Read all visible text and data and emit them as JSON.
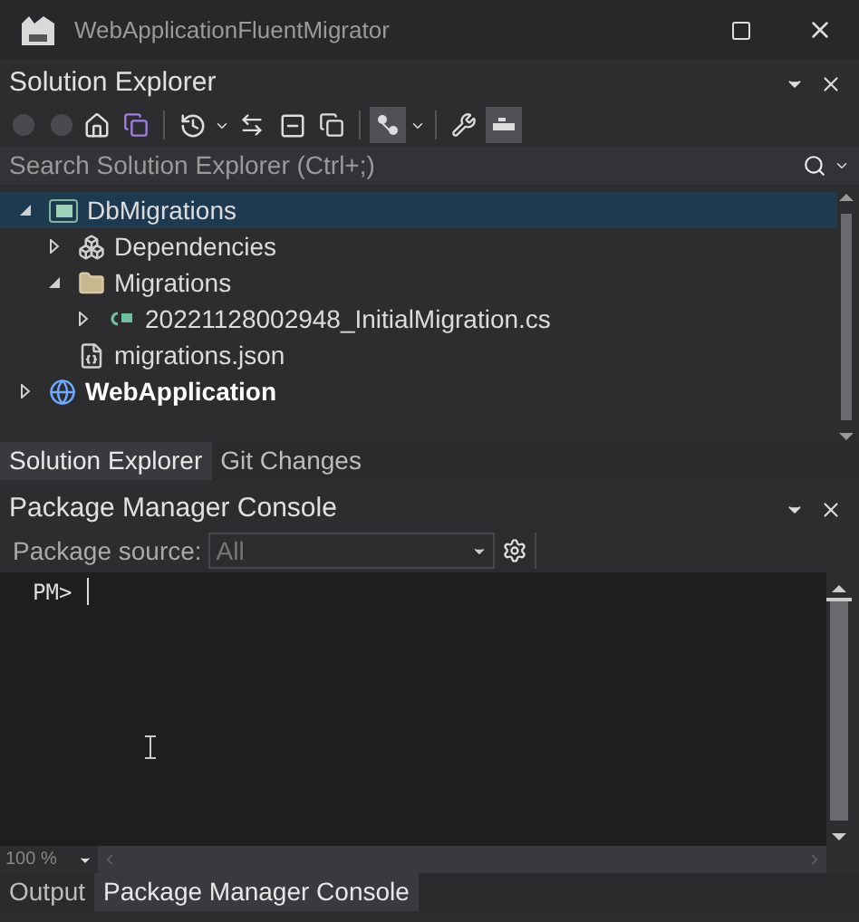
{
  "window": {
    "title": "WebApplicationFluentMigrator"
  },
  "solution_explorer": {
    "title": "Solution Explorer",
    "search": {
      "placeholder": "Search Solution Explorer (Ctrl+;)"
    },
    "tree": [
      {
        "label": "DbMigrations",
        "kind": "project",
        "expanded": true,
        "selected": true,
        "startup": false,
        "children": [
          {
            "label": "Dependencies",
            "kind": "dependencies",
            "expanded": false,
            "selected": false,
            "startup": false
          },
          {
            "label": "Migrations",
            "kind": "folder",
            "expanded": true,
            "selected": false,
            "startup": false,
            "children": [
              {
                "label": "20221128002948_InitialMigration.cs",
                "kind": "csfile",
                "expanded": false,
                "selected": false,
                "startup": false
              }
            ]
          },
          {
            "label": "migrations.json",
            "kind": "json",
            "selected": false,
            "startup": false
          }
        ]
      },
      {
        "label": "WebApplication",
        "kind": "webproject",
        "expanded": false,
        "selected": false,
        "startup": true
      }
    ],
    "tabs": [
      {
        "label": "Solution Explorer",
        "selected": true
      },
      {
        "label": "Git Changes",
        "selected": false
      }
    ]
  },
  "package_manager_console": {
    "title": "Package Manager Console",
    "source_label": "Package source:",
    "source_value": "All",
    "prompt": "PM>",
    "zoom": "100 %",
    "tabs": [
      {
        "label": "Output",
        "selected": false
      },
      {
        "label": "Package Manager Console",
        "selected": true
      }
    ]
  }
}
